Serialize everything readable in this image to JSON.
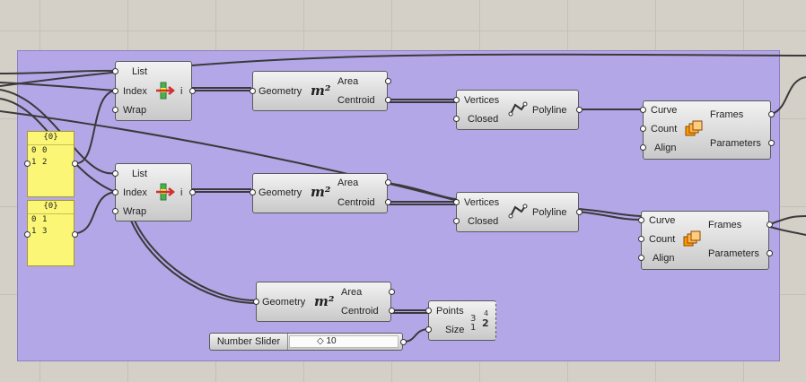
{
  "list_item": {
    "in_list": "List",
    "in_index": "Index",
    "in_wrap": "Wrap",
    "out_item": "i"
  },
  "area": {
    "in_geometry": "Geometry",
    "out_area": "Area",
    "out_centroid": "Centroid",
    "icon_text": "m²"
  },
  "polyline": {
    "in_vertices": "Vertices",
    "in_closed": "Closed",
    "out_polyline": "Polyline"
  },
  "perp_frames": {
    "in_curve": "Curve",
    "in_count": "Count",
    "in_align": "Align",
    "out_frames": "Frames",
    "out_parameters": "Parameters"
  },
  "panel1": {
    "header": "{0}",
    "rows": [
      {
        "index": "0",
        "value": "0"
      },
      {
        "index": "1",
        "value": "2"
      }
    ]
  },
  "panel2": {
    "header": "{0}",
    "rows": [
      {
        "index": "0",
        "value": "1"
      },
      {
        "index": "1",
        "value": "3"
      }
    ]
  },
  "number_slider": {
    "name": "Number Slider",
    "value": "◇ 10"
  },
  "points_list": {
    "in_points": "Points",
    "in_size": "Size"
  },
  "colors": {
    "group": "#b4a7e8",
    "canvas": "#d4d0c8",
    "panel": "#fbf675",
    "wire": "#3a3a3a"
  }
}
